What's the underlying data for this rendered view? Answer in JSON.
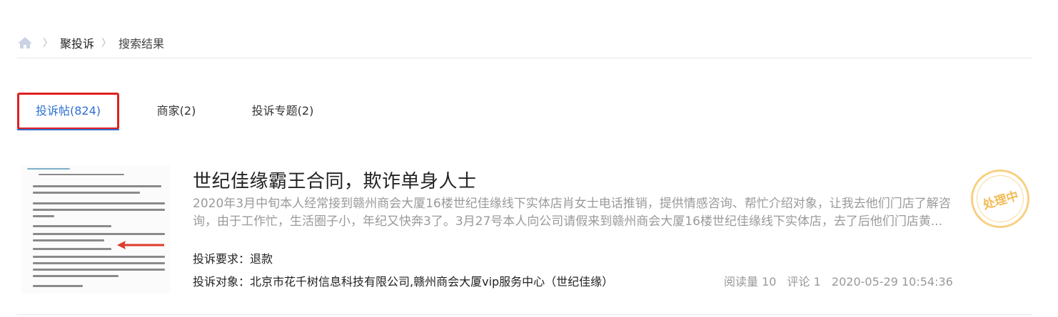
{
  "breadcrumb": {
    "home_icon": "home-icon",
    "items": [
      "聚投诉",
      "搜索结果"
    ]
  },
  "tabs": [
    {
      "label": "投诉帖(824)",
      "active": true
    },
    {
      "label": "商家(2)",
      "active": false
    },
    {
      "label": "投诉专题(2)",
      "active": false
    }
  ],
  "colors": {
    "active_tab": "#2e6fd2",
    "highlight_box": "#e02020",
    "stamp": "#f0b23c"
  },
  "complaint": {
    "title": "世纪佳缘霸王合同，欺诈单身人士",
    "summary": "2020年3月中旬本人经常接到赣州商会大厦16楼世纪佳缘线下实体店肖女士电话推销，提供情感咨询、帮忙介绍对象，让我去他们门店了解咨询，由于工作忙，生活圈子小，年纪又快奔3了。3月27号本人向公司请假来到赣州商会大厦16楼世纪佳缘线下实体店，去了后他们门店黄...",
    "demand_label": "投诉要求：",
    "demand_value": "退款",
    "target_label": "投诉对象：",
    "target_value": "北京市花千树信息科技有限公司,赣州商会大厦vip服务中心（世纪佳缘）",
    "reads": "阅读量 10",
    "comments": "评论 1",
    "datetime": "2020-05-29 10:54:36",
    "status": "处理中",
    "thumbnail_icon": "document-screenshot"
  }
}
